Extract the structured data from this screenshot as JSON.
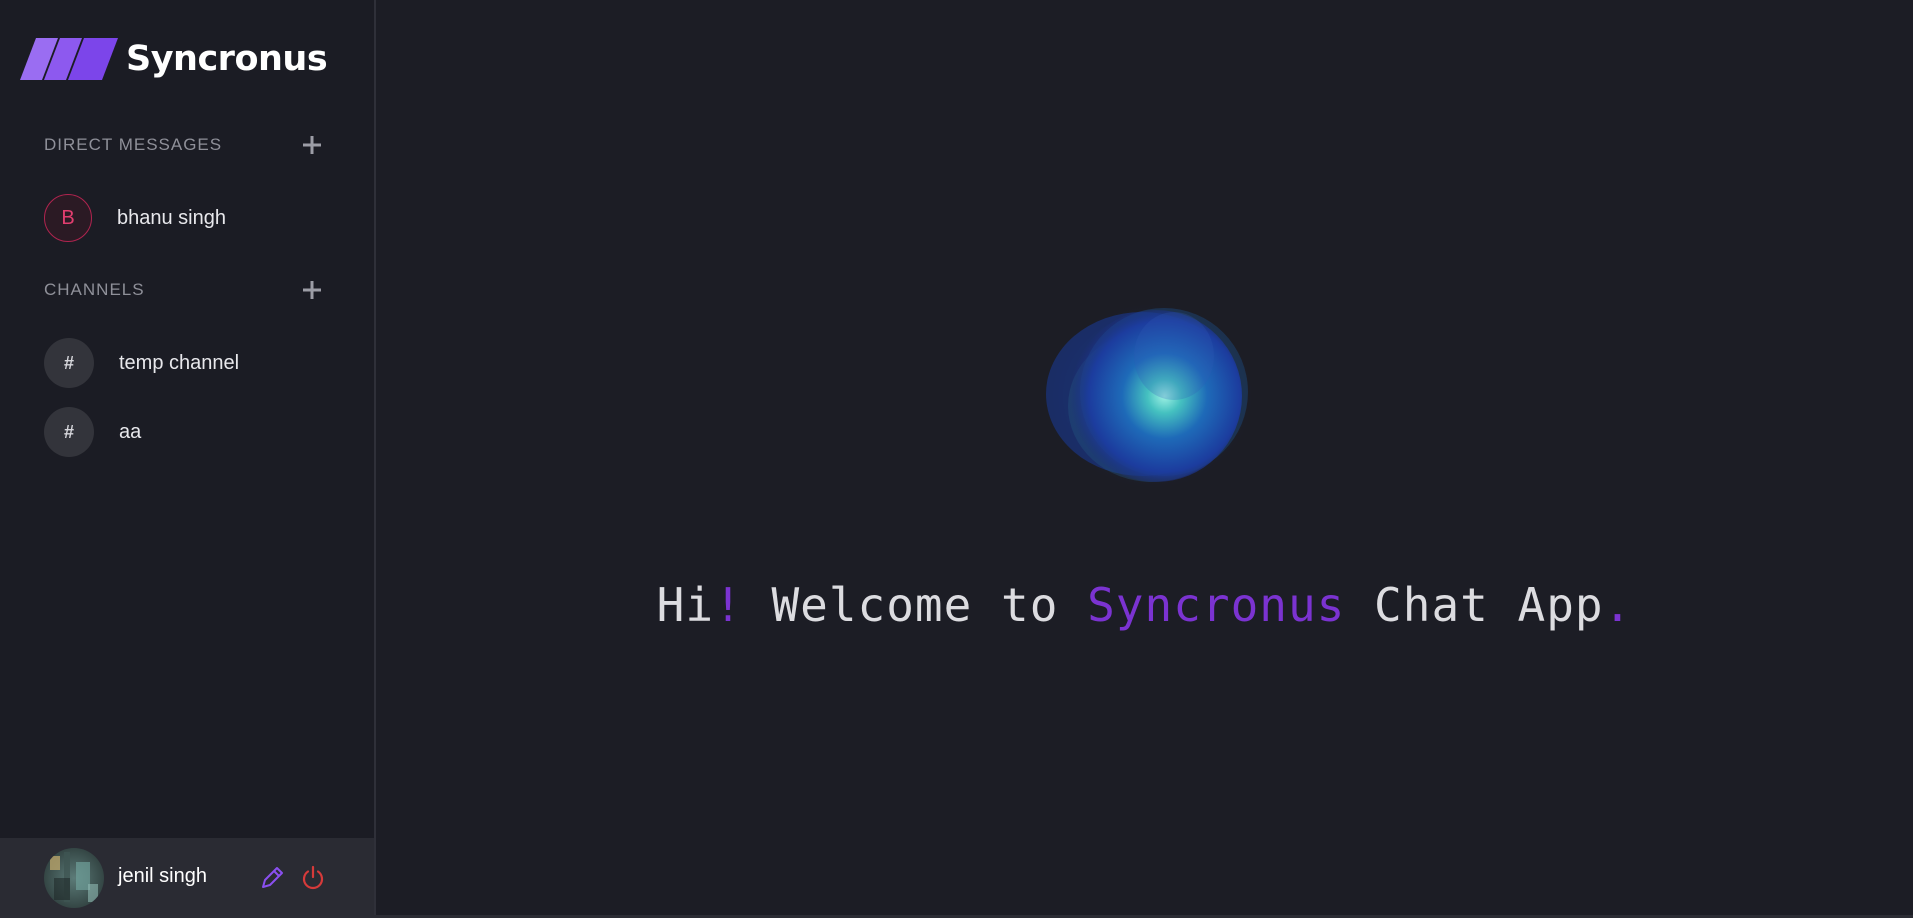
{
  "brand": {
    "name": "Syncronus",
    "accent_color": "#8a4ff0"
  },
  "sidebar": {
    "direct_messages": {
      "title": "DIRECT MESSAGES",
      "items": [
        {
          "initial": "B",
          "label": "bhanu singh",
          "avatar_color": "#e23e6f"
        }
      ]
    },
    "channels": {
      "title": "CHANNELS",
      "items": [
        {
          "symbol": "#",
          "label": "temp channel"
        },
        {
          "symbol": "#",
          "label": "aa"
        }
      ]
    }
  },
  "profile": {
    "name": "jenil singh",
    "edit_icon": "pencil-icon",
    "logout_icon": "power-icon",
    "edit_color": "#8a4ff0",
    "logout_color": "#d63a3a"
  },
  "main": {
    "welcome": {
      "part1": "Hi",
      "part2": "!",
      "part3": " Welcome to ",
      "part4": "Syncronus",
      "part5": " Chat App",
      "part6": "."
    }
  }
}
